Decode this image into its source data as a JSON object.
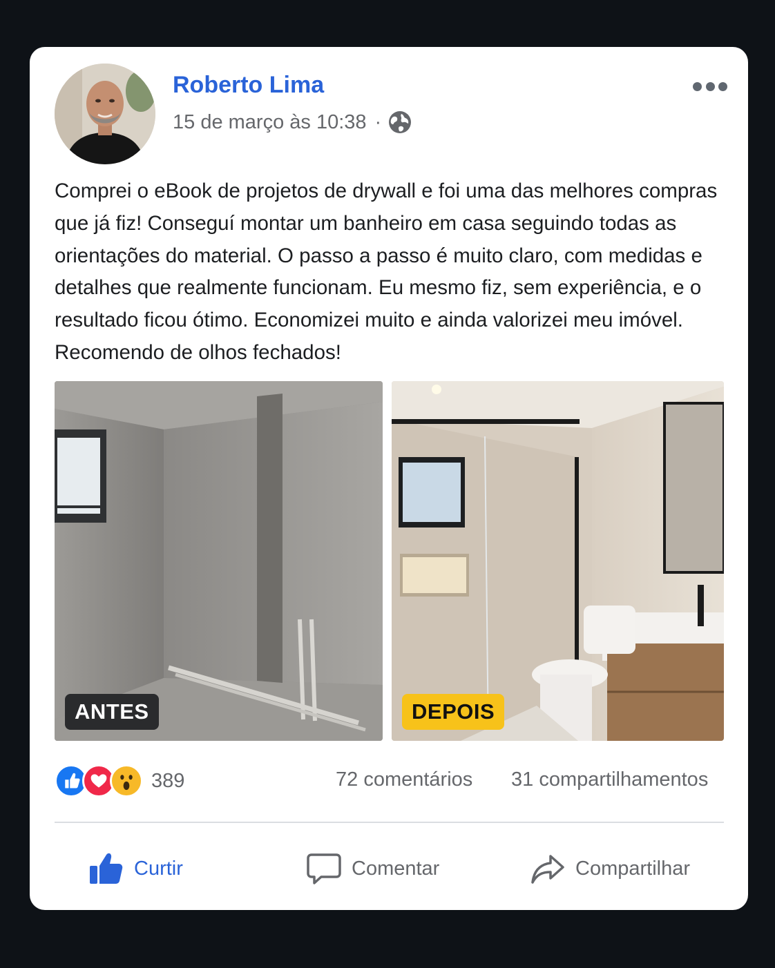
{
  "post": {
    "author": "Roberto Lima",
    "timestamp": "15 de março às 10:38",
    "separator": "·",
    "privacy_icon": "globe-icon",
    "text": "Comprei o eBook de projetos de drywall e foi uma das melhores compras que já fiz! Conseguí montar um banheiro em casa seguindo todas as orientações do material. O passo a passo é muito claro, com medidas e detalhes que realmente funcionam. Eu mesmo fiz, sem experiência, e o resultado ficou ótimo. Economizei muito e ainda valorizei meu imóvel. Recomendo de olhos fechados!",
    "photos": {
      "before_label": "ANTES",
      "after_label": "DEPOIS"
    }
  },
  "stats": {
    "reaction_icons": [
      "like-icon",
      "love-icon",
      "wow-icon"
    ],
    "reactions": "389",
    "comments": "72 comentários",
    "shares": "31 compartilhamentos"
  },
  "actions": {
    "like": "Curtir",
    "comment": "Comentar",
    "share": "Compartilhar"
  },
  "colors": {
    "accent": "#2a63d8",
    "muted": "#65676b",
    "badge_after": "#f7c21a",
    "badge_before": "#2a2b2d",
    "page_bg": "#0e1217"
  }
}
